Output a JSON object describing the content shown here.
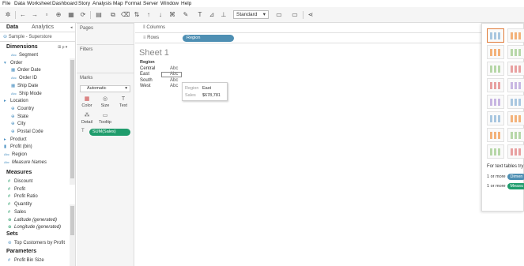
{
  "menu": [
    "File",
    "Data",
    "Worksheet",
    "Dashboard",
    "Story",
    "Analysis",
    "Map",
    "Format",
    "Server",
    "Window",
    "Help"
  ],
  "toolbar": {
    "fit_select": "Standard"
  },
  "left": {
    "tab_data": "Data",
    "tab_analytics": "Analytics",
    "datasource": "Sample - Superstore",
    "dimensions_label": "Dimensions",
    "dimensions": [
      {
        "label": "Segment",
        "indent": 2,
        "icon": "Abc"
      },
      {
        "label": "Order",
        "indent": 1,
        "icon": "folder"
      },
      {
        "label": "Order Date",
        "indent": 2,
        "icon": "date"
      },
      {
        "label": "Order ID",
        "indent": 2,
        "icon": "Abc"
      },
      {
        "label": "Ship Date",
        "indent": 2,
        "icon": "date"
      },
      {
        "label": "Ship Mode",
        "indent": 2,
        "icon": "Abc"
      },
      {
        "label": "Location",
        "indent": 1,
        "icon": "hierarchy"
      },
      {
        "label": "Country",
        "indent": 2,
        "icon": "geo"
      },
      {
        "label": "State",
        "indent": 2,
        "icon": "geo"
      },
      {
        "label": "City",
        "indent": 2,
        "icon": "geo"
      },
      {
        "label": "Postal Code",
        "indent": 2,
        "icon": "geo"
      },
      {
        "label": "Product",
        "indent": 1,
        "icon": "hierarchy"
      },
      {
        "label": "Profit (bin)",
        "indent": 1,
        "icon": "bin"
      },
      {
        "label": "Region",
        "indent": 1,
        "icon": "Abc"
      },
      {
        "label": "Measure Names",
        "indent": 1,
        "icon": "Abc",
        "italic": true
      }
    ],
    "measures_label": "Measures",
    "measures": [
      {
        "label": "Discount"
      },
      {
        "label": "Profit"
      },
      {
        "label": "Profit Ratio"
      },
      {
        "label": "Quantity"
      },
      {
        "label": "Sales"
      },
      {
        "label": "Latitude (generated)",
        "italic": true
      },
      {
        "label": "Longitude (generated)",
        "italic": true
      }
    ],
    "sets_label": "Sets",
    "sets": [
      "Top Customers by Profit"
    ],
    "parameters_label": "Parameters",
    "parameters": [
      "Profit Bin Size"
    ]
  },
  "cards": {
    "pages": "Pages",
    "filters": "Filters",
    "marks": "Marks",
    "mark_type": "Automatic",
    "buttons": [
      "Color",
      "Size",
      "Text",
      "Detail",
      "Tooltip"
    ],
    "measure_pill": "SUM(Sales)"
  },
  "shelves": {
    "columns": "Columns",
    "rows": "Rows",
    "rows_pill": "Region"
  },
  "view": {
    "title": "Sheet 1",
    "header": "Region",
    "rows": [
      {
        "label": "Central",
        "value": "Abc"
      },
      {
        "label": "East",
        "value": "Abc"
      },
      {
        "label": "South",
        "value": "Abc"
      },
      {
        "label": "West",
        "value": "Abc"
      }
    ],
    "tooltip": {
      "k1": "Region",
      "v1": "East",
      "k2": "Sales",
      "v2": "$678,781"
    }
  },
  "showme": {
    "hint": "For text tables try",
    "line1_prefix": "1 or more",
    "line1_pill": "Dimen",
    "line2_prefix": "1 or more",
    "line2_pill": "Measu",
    "dim_color": "#4e8fb3",
    "meas_color": "#1f9c6c"
  }
}
